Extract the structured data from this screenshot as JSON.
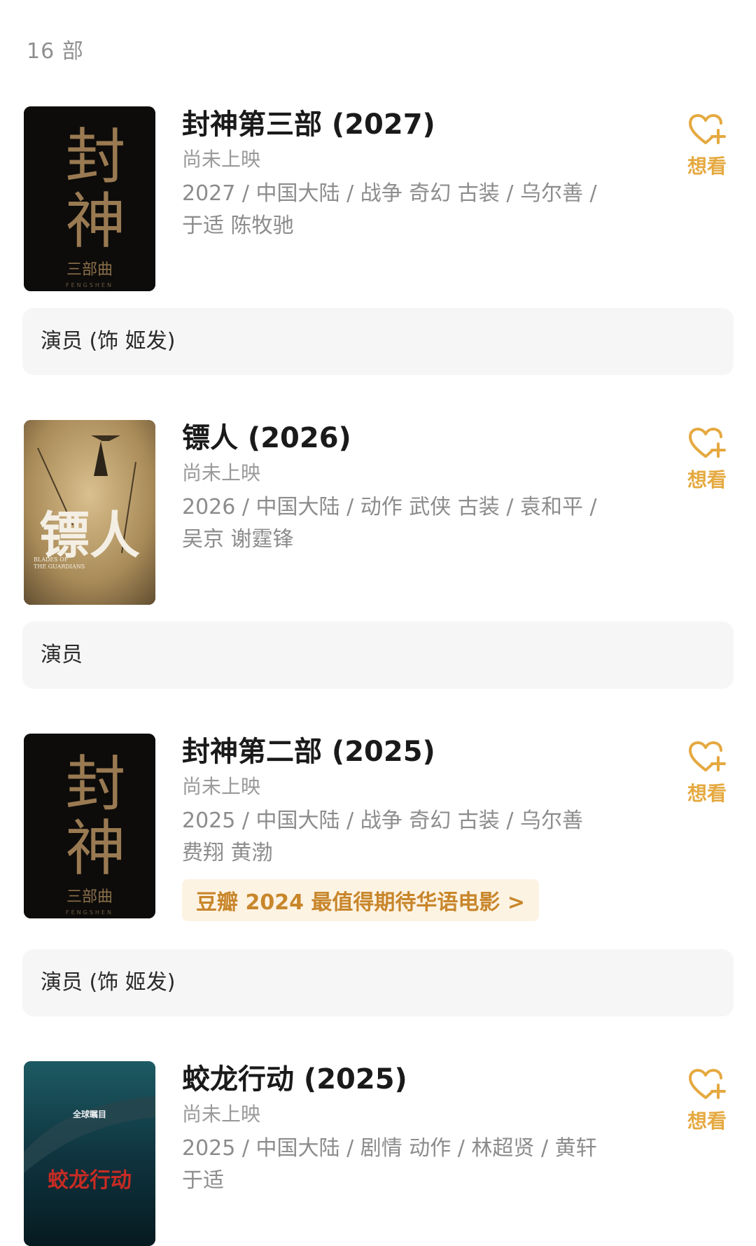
{
  "count_label": "16 部",
  "movies": [
    {
      "title": "封神第三部 (2027)",
      "status": "尚未上映",
      "meta_line1": "2027 / 中国大陆 / 战争 奇幻 古装 / 乌尔善 /",
      "meta_line2": "于适 陈牧驰",
      "want_label": "想看",
      "role": "演员 (饰 姬发)",
      "poster": {
        "big_text": "封神",
        "sub_text": "三部曲",
        "latin": "FENGSHEN"
      }
    },
    {
      "title": "镖人 (2026)",
      "status": "尚未上映",
      "meta_line1": "2026 / 中国大陆 / 动作 武侠 古装 / 袁和平 /",
      "meta_line2": "吴京 谢霆锋",
      "want_label": "想看",
      "role": "演员",
      "poster": {
        "big_text": "镖人",
        "latin1": "BLADES OF",
        "latin2": "THE GUARDIANS"
      }
    },
    {
      "title": "封神第二部 (2025)",
      "status": "尚未上映",
      "meta_line1": "2025 / 中国大陆 / 战争 奇幻 古装 / 乌尔善",
      "meta_line2": "费翔 黄渤",
      "award": "豆瓣 2024 最值得期待华语电影 >",
      "want_label": "想看",
      "role": "演员 (饰 姬发)",
      "poster": {
        "big_text": "封神",
        "sub_text": "三部曲",
        "latin": "FENGSHEN"
      }
    },
    {
      "title": "蛟龙行动 (2025)",
      "status": "尚未上映",
      "meta_line1": "2025 / 中国大陆 / 剧情 动作 / 林超贤 / 黄轩",
      "meta_line2": "于适",
      "want_label": "想看",
      "poster": {
        "top_text": "全球瞩目",
        "big_text": "蛟龙行动"
      }
    }
  ],
  "colors": {
    "accent": "#e5a940",
    "award_text": "#c8862b",
    "award_bg": "#fdf3e3",
    "role_bg": "#f6f6f6",
    "secondary_text": "#8c8c8c"
  },
  "icons": {
    "want": "heart-plus-icon"
  }
}
